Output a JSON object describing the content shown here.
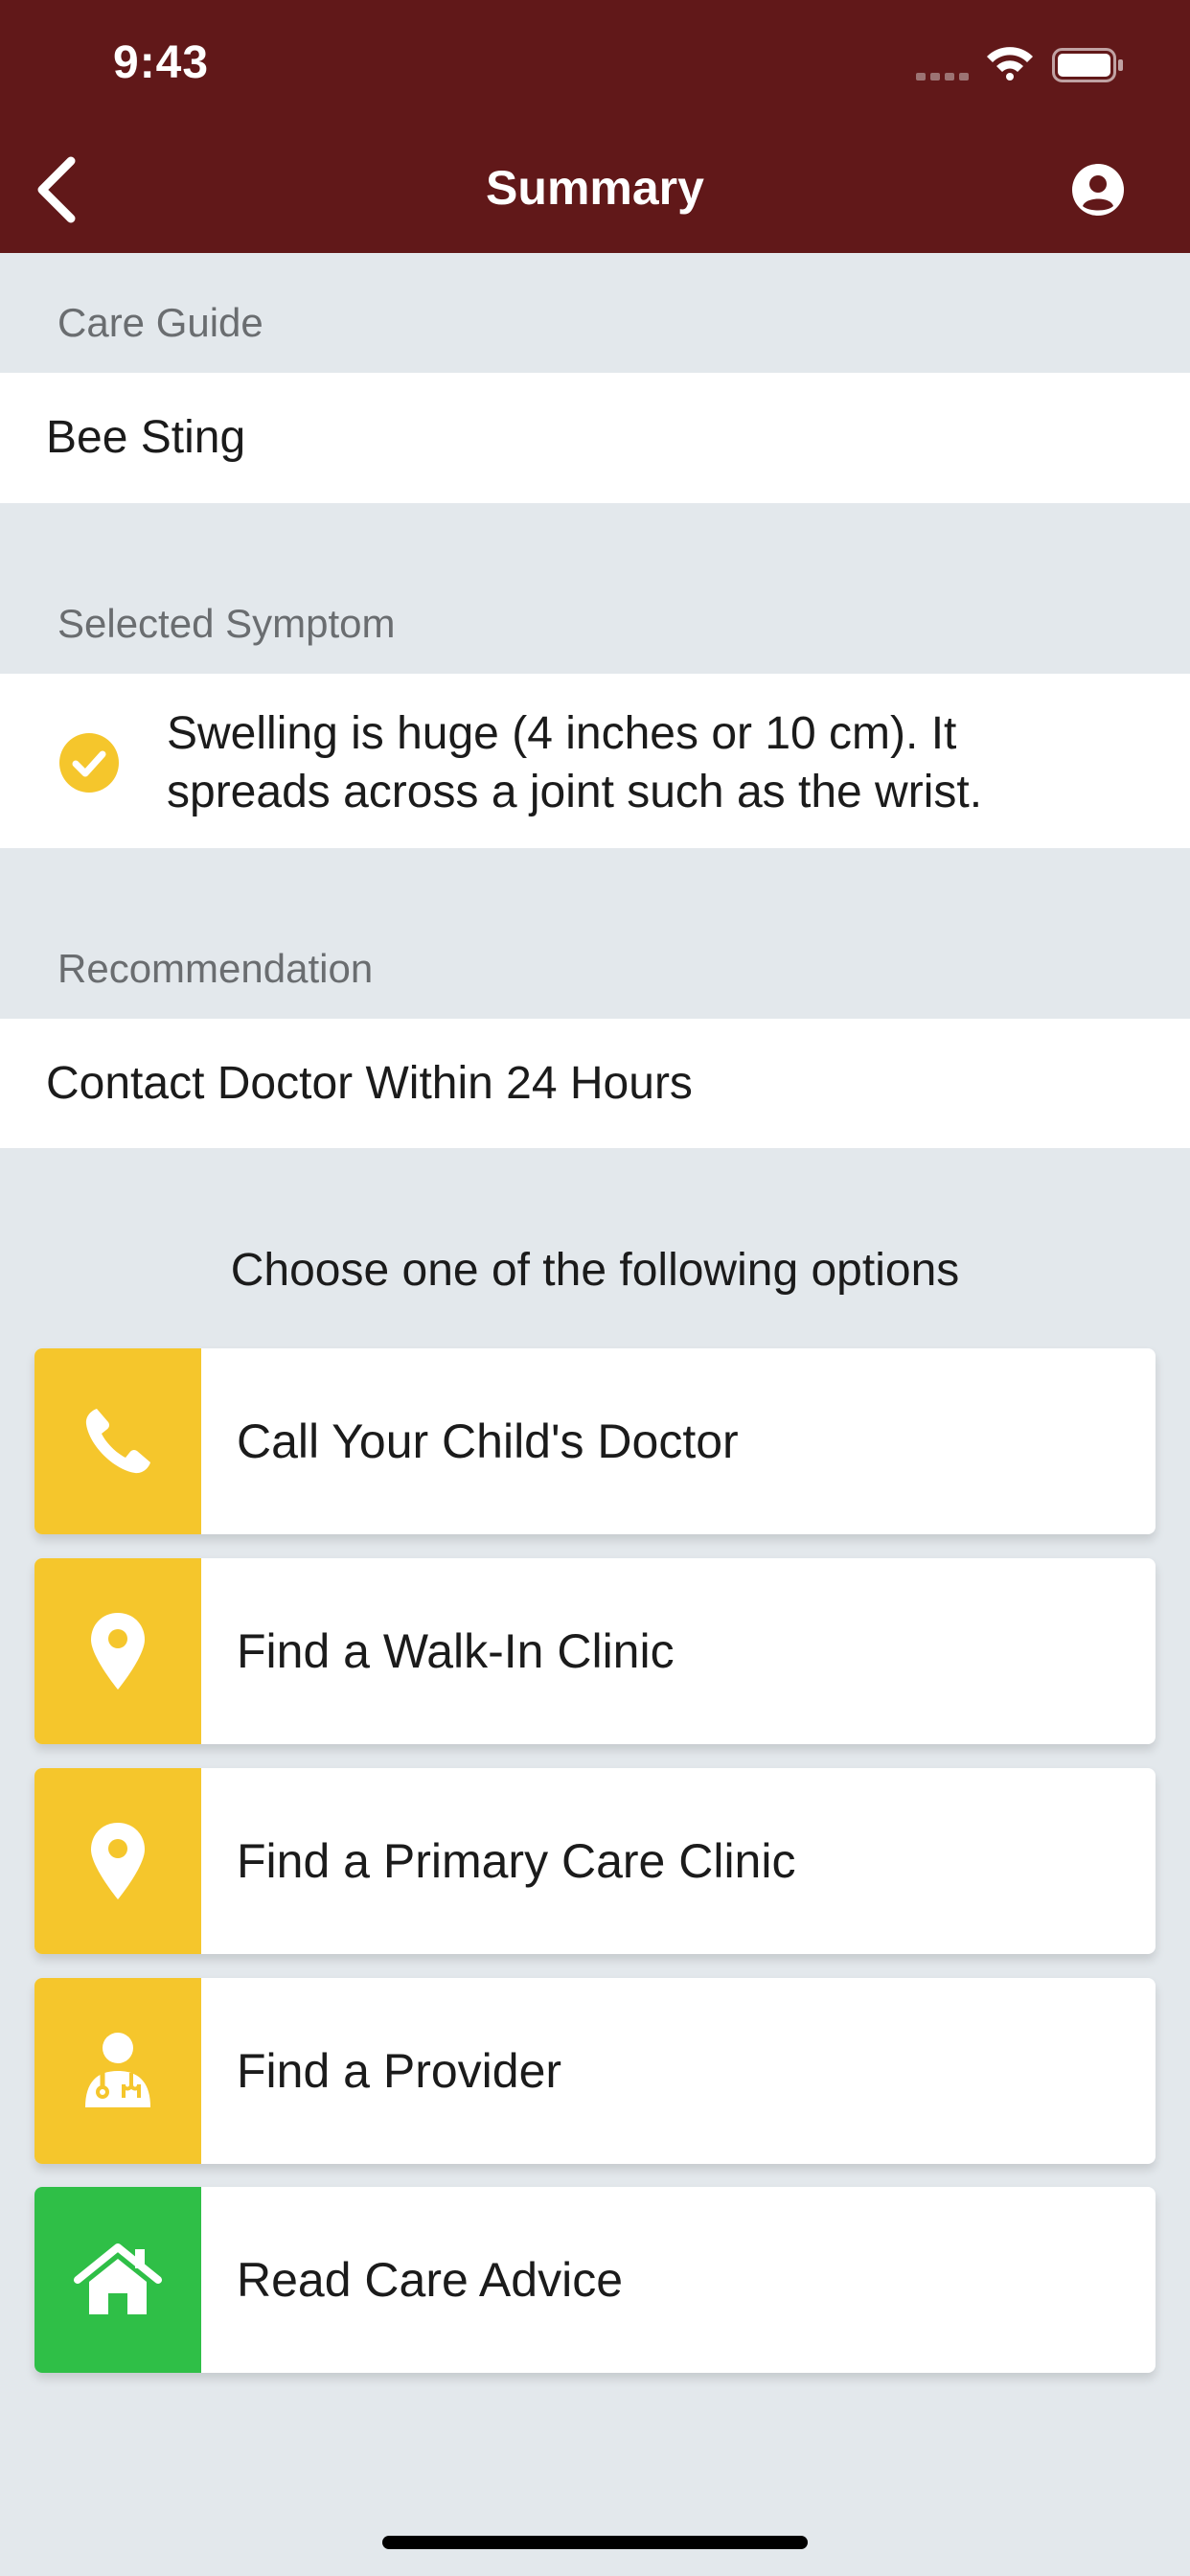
{
  "status_bar": {
    "time": "9:43"
  },
  "header": {
    "title": "Summary"
  },
  "care_guide": {
    "label": "Care Guide",
    "value": "Bee Sting"
  },
  "selected_symptom": {
    "label": "Selected Symptom",
    "line1": "Swelling is huge (4 inches or 10 cm). It",
    "line2": "spreads across a joint such as the wrist."
  },
  "recommendation": {
    "label": "Recommendation",
    "value": "Contact Doctor Within 24 Hours"
  },
  "options": {
    "heading": "Choose one of the following options",
    "items": [
      {
        "label": "Call Your Child's Doctor",
        "icon": "phone-icon",
        "color": "#f5c62c"
      },
      {
        "label": "Find a Walk-In Clinic",
        "icon": "map-pin-icon",
        "color": "#f5c62c"
      },
      {
        "label": "Find a Primary Care Clinic",
        "icon": "map-pin-icon",
        "color": "#f5c62c"
      },
      {
        "label": "Find a Provider",
        "icon": "doctor-icon",
        "color": "#f5c62c"
      },
      {
        "label": "Read Care Advice",
        "icon": "home-icon",
        "color": "#2fbf47"
      }
    ]
  },
  "colors": {
    "header": "#611819",
    "accent_yellow": "#f5c62c",
    "accent_green": "#2fbf47",
    "background": "#e3e8ec"
  }
}
